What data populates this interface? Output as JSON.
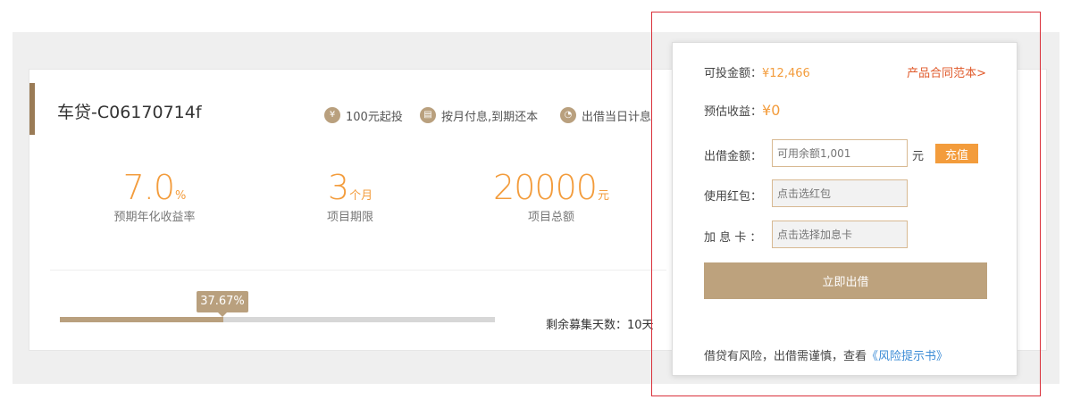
{
  "product": {
    "title": "车贷-C06170714f",
    "tags": [
      {
        "icon": "yuan-icon",
        "label": "100元起投"
      },
      {
        "icon": "calendar-icon",
        "label": "按月付息,到期还本"
      },
      {
        "icon": "clock-icon",
        "label": "出借当日计息"
      }
    ],
    "stats": [
      {
        "value": "7.0",
        "unit": "%",
        "label": "预期年化收益率"
      },
      {
        "value": "3",
        "unit": "个月",
        "label": "项目期限"
      },
      {
        "value": "20000",
        "unit": "元",
        "label": "项目总额"
      }
    ],
    "progress": {
      "percent_label": "37.67%",
      "percent": 37.67
    },
    "remaining_days": "剩余募集天数：10天"
  },
  "panel": {
    "available_label": "可投金额：",
    "available_value": "¥12,466",
    "contract_link": "产品合同范本>",
    "expected_label": "预估收益：",
    "expected_value": "¥0",
    "amount_label": "出借金额：",
    "amount_placeholder": "可用余额1,001",
    "amount_unit": "元",
    "recharge_label": "充值",
    "redpacket_label": "使用红包：",
    "redpacket_placeholder": "点击选红包",
    "bonus_label": "加 息 卡 ：",
    "bonus_placeholder": "点击选择加息卡",
    "invest_button": "立即出借",
    "risk_text": "借贷有风险，出借需谨慎，查看",
    "risk_link": "《风险提示书》"
  },
  "colors": {
    "accent": "#b9a07e",
    "orange": "#f39c3c",
    "link_blue": "#3d8cd6",
    "outline_red": "#d9303a"
  }
}
